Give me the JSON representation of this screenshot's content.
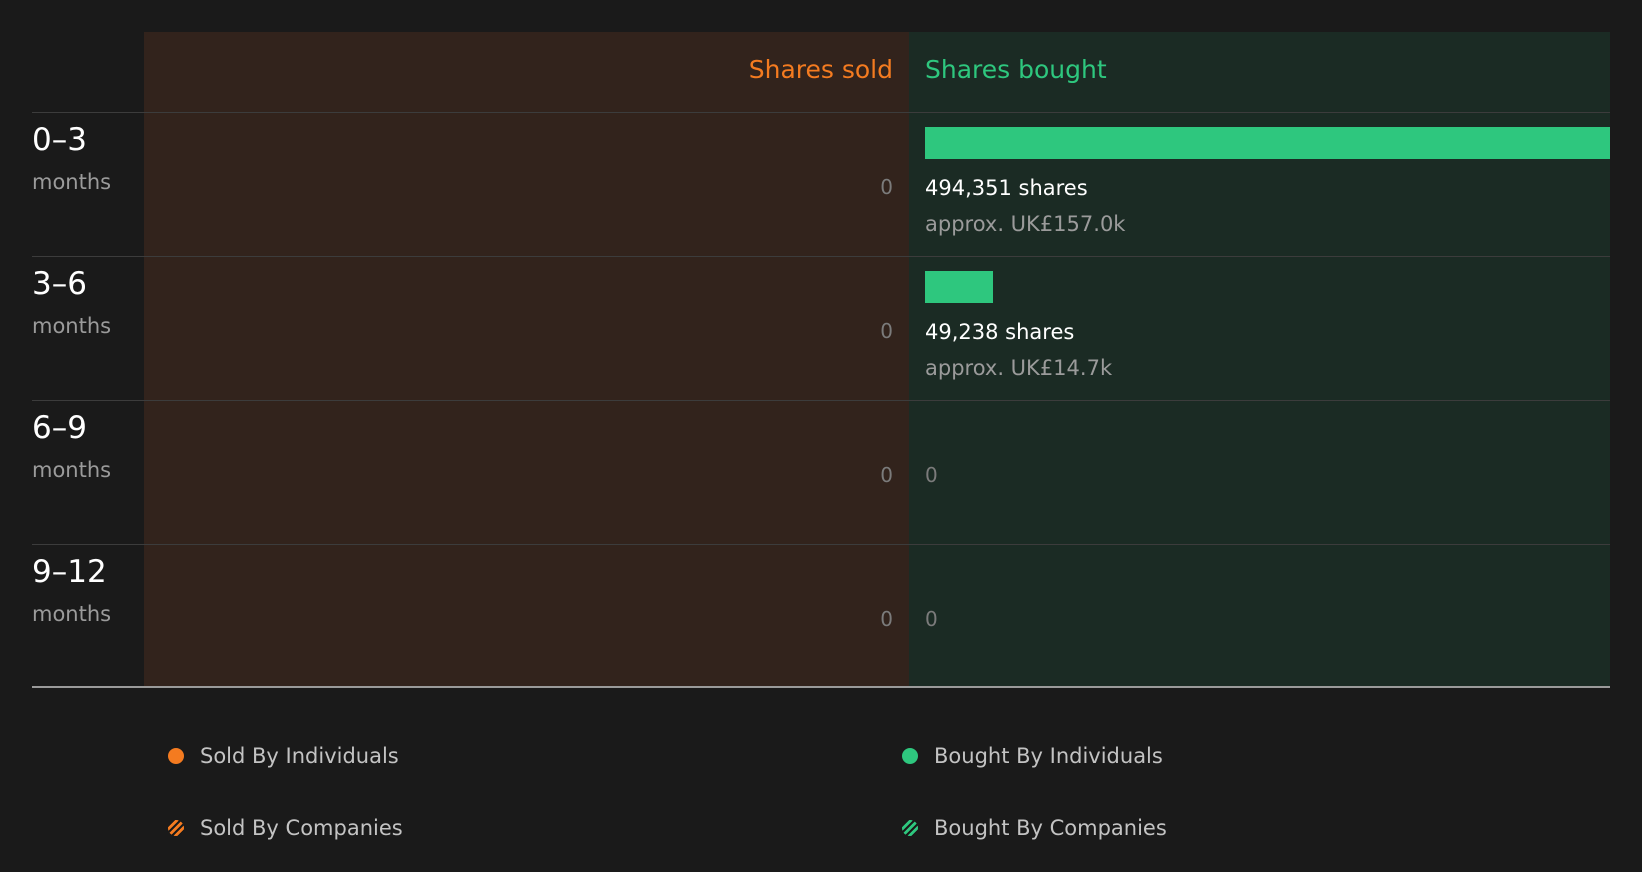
{
  "chart_data": {
    "type": "bar",
    "headers": {
      "sold": "Shares sold",
      "bought": "Shares bought"
    },
    "categories": [
      {
        "range": "0–3",
        "unit": "months"
      },
      {
        "range": "3–6",
        "unit": "months"
      },
      {
        "range": "6–9",
        "unit": "months"
      },
      {
        "range": "9–12",
        "unit": "months"
      }
    ],
    "series": [
      {
        "name": "Shares sold",
        "values": [
          0,
          0,
          0,
          0
        ]
      },
      {
        "name": "Shares bought",
        "values": [
          494351,
          49238,
          0,
          0
        ]
      }
    ],
    "rows": [
      {
        "sold_label": "0",
        "bought_label": "494,351 shares",
        "bought_value_label": "approx. UK£157.0k"
      },
      {
        "sold_label": "0",
        "bought_label": "49,238 shares",
        "bought_value_label": "approx. UK£14.7k"
      },
      {
        "sold_label": "0",
        "bought_label": "0",
        "bought_value_label": ""
      },
      {
        "sold_label": "0",
        "bought_label": "0",
        "bought_value_label": ""
      }
    ],
    "legend": [
      {
        "label": "Sold By Individuals",
        "color": "#f47b20",
        "pattern": "solid"
      },
      {
        "label": "Bought By Individuals",
        "color": "#2ec77e",
        "pattern": "solid"
      },
      {
        "label": "Sold By Companies",
        "color": "#f47b20",
        "pattern": "hatched"
      },
      {
        "label": "Bought By Companies",
        "color": "#2ec77e",
        "pattern": "hatched"
      }
    ],
    "legend_placement": "bottom",
    "colors": {
      "sold": "#f47b20",
      "bought": "#2ec77e",
      "sold_bg": "#32231c",
      "bought_bg": "#1b2b24"
    }
  }
}
